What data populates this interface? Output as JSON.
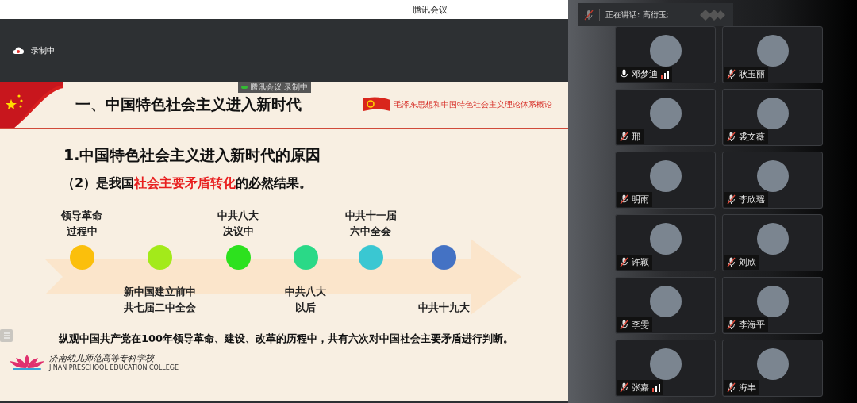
{
  "window": {
    "title": "腾讯会议"
  },
  "recording": {
    "label": "录制中"
  },
  "speaker_banner": {
    "text": "正在讲话: 高衍玉;"
  },
  "slide": {
    "overlay_badge": [
      "腾讯会议",
      "录制中"
    ],
    "title": "一、中国特色社会主义进入新时代",
    "course_name": "毛泽东思想和中国特色社会主义理论体系概论",
    "heading": "1.中国特色社会主义进入新时代的原因",
    "subheading": [
      {
        "text": "（2）是我国",
        "emphasis": false
      },
      {
        "text": "社会主要矛盾转化",
        "emphasis": true
      },
      {
        "text": "的必然结果。",
        "emphasis": false
      }
    ],
    "timeline": [
      {
        "label": [
          "领导革命",
          "过程中"
        ],
        "kind": "above",
        "color": "#fbbf0c"
      },
      {
        "label": [
          "新中国建立前中",
          "共七届二中全会"
        ],
        "kind": "below",
        "color": "#a3ea1a"
      },
      {
        "label": [
          "中共八大",
          "决议中"
        ],
        "kind": "above",
        "color": "#2de11e"
      },
      {
        "label": [
          "中共八大",
          "以后"
        ],
        "kind": "below",
        "color": "#2ad987"
      },
      {
        "label": [
          "中共十一届",
          "六中全会"
        ],
        "kind": "above",
        "color": "#3ac7d2"
      },
      {
        "label": [
          "中共十九大"
        ],
        "kind": "below",
        "color": "#4472c4"
      }
    ],
    "summary": "纵观中国共产党在100年领导革命、建设、改革的历程中，共有六次对中国社会主要矛盾进行判断。",
    "school_name": "济南幼儿师范高等专科学校",
    "school_name_en": "JINAN PRESCHOOL EDUCATION COLLEGE"
  },
  "participants": [
    {
      "name": "邓梦迪",
      "muted": false,
      "signal": true
    },
    {
      "name": "耿玉丽",
      "muted": true,
      "signal": false
    },
    {
      "name": "邢",
      "muted": true,
      "signal": false
    },
    {
      "name": "裘文薇",
      "muted": true,
      "signal": false
    },
    {
      "name": "明雨",
      "muted": true,
      "signal": false
    },
    {
      "name": "李欣瑶",
      "muted": true,
      "signal": false
    },
    {
      "name": "许颖",
      "muted": true,
      "signal": false
    },
    {
      "name": "刘欣",
      "muted": true,
      "signal": false
    },
    {
      "name": "李雯",
      "muted": true,
      "signal": false
    },
    {
      "name": "李海平",
      "muted": true,
      "signal": false
    },
    {
      "name": "张嘉",
      "muted": true,
      "signal": true
    },
    {
      "name": "海丰",
      "muted": true,
      "signal": false
    }
  ]
}
